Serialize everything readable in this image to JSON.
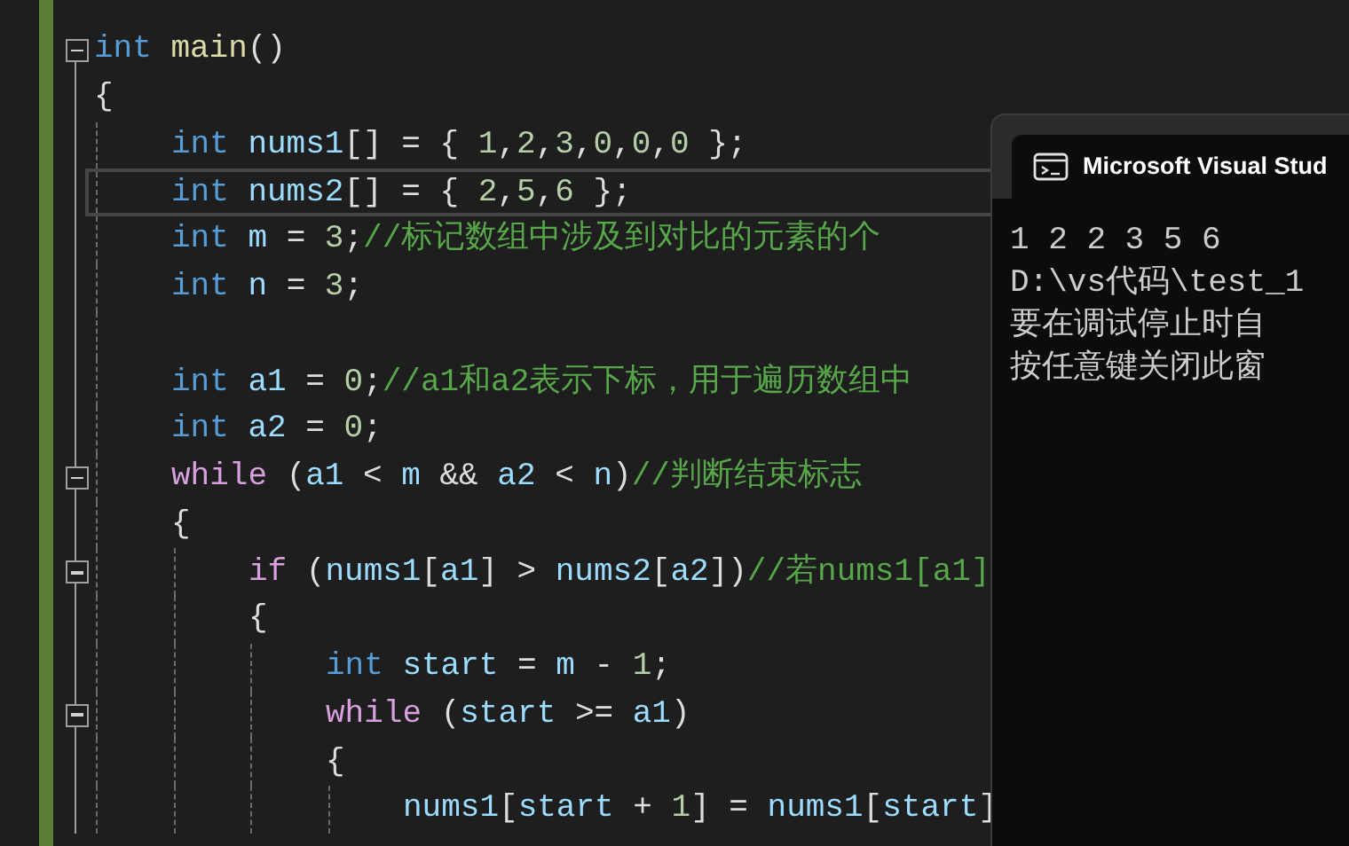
{
  "editor": {
    "lines": [
      {
        "kind": "code",
        "tokens": [
          {
            "kind": "keyword",
            "text": "int"
          },
          {
            "kind": "function",
            "text": " main"
          },
          {
            "kind": "punct",
            "text": "()"
          }
        ],
        "fold": {
          "expanded": true
        }
      },
      {
        "kind": "code",
        "tokens": [
          {
            "kind": "punct",
            "text": "{"
          }
        ],
        "children": [
          {
            "kind": "code",
            "tokens": [
              {
                "kind": "keyword",
                "text": "int"
              },
              {
                "kind": "variable",
                "text": " nums1"
              },
              {
                "kind": "punct",
                "text": "[] = { "
              },
              {
                "kind": "number",
                "text": "1"
              },
              {
                "kind": "punct",
                "text": ","
              },
              {
                "kind": "number",
                "text": "2"
              },
              {
                "kind": "punct",
                "text": ","
              },
              {
                "kind": "number",
                "text": "3"
              },
              {
                "kind": "punct",
                "text": ","
              },
              {
                "kind": "number",
                "text": "0"
              },
              {
                "kind": "punct",
                "text": ","
              },
              {
                "kind": "number",
                "text": "0"
              },
              {
                "kind": "punct",
                "text": ","
              },
              {
                "kind": "number",
                "text": "0"
              },
              {
                "kind": "punct",
                "text": " };"
              }
            ]
          },
          {
            "kind": "code",
            "tokens": [
              {
                "kind": "keyword",
                "text": "int"
              },
              {
                "kind": "variable",
                "text": " nums2"
              },
              {
                "kind": "punct",
                "text": "[] = { "
              },
              {
                "kind": "number",
                "text": "2"
              },
              {
                "kind": "punct",
                "text": ","
              },
              {
                "kind": "number",
                "text": "5"
              },
              {
                "kind": "punct",
                "text": ","
              },
              {
                "kind": "number",
                "text": "6"
              },
              {
                "kind": "punct",
                "text": " };"
              }
            ],
            "selected": true
          },
          {
            "kind": "code",
            "tokens": [
              {
                "kind": "keyword",
                "text": "int"
              },
              {
                "kind": "variable",
                "text": " m"
              },
              {
                "kind": "punct",
                "text": " = "
              },
              {
                "kind": "number",
                "text": "3"
              },
              {
                "kind": "punct",
                "text": ";"
              },
              {
                "kind": "comment",
                "text": "//标记数组中涉及到对比的元素的个"
              }
            ]
          },
          {
            "kind": "code",
            "tokens": [
              {
                "kind": "keyword",
                "text": "int"
              },
              {
                "kind": "variable",
                "text": " n"
              },
              {
                "kind": "punct",
                "text": " = "
              },
              {
                "kind": "number",
                "text": "3"
              },
              {
                "kind": "punct",
                "text": ";"
              }
            ]
          },
          {
            "kind": "blank"
          },
          {
            "kind": "code",
            "tokens": [
              {
                "kind": "keyword",
                "text": "int"
              },
              {
                "kind": "variable",
                "text": " a1"
              },
              {
                "kind": "punct",
                "text": " = "
              },
              {
                "kind": "number",
                "text": "0"
              },
              {
                "kind": "punct",
                "text": ";"
              },
              {
                "kind": "comment",
                "text": "//a1和a2表示下标，用于遍历数组中"
              }
            ]
          },
          {
            "kind": "code",
            "tokens": [
              {
                "kind": "keyword",
                "text": "int"
              },
              {
                "kind": "variable",
                "text": " a2"
              },
              {
                "kind": "punct",
                "text": " = "
              },
              {
                "kind": "number",
                "text": "0"
              },
              {
                "kind": "punct",
                "text": ";"
              }
            ]
          },
          {
            "kind": "code",
            "tokens": [
              {
                "kind": "control",
                "text": "while"
              },
              {
                "kind": "punct",
                "text": " ("
              },
              {
                "kind": "variable",
                "text": "a1"
              },
              {
                "kind": "punct",
                "text": " < "
              },
              {
                "kind": "variable",
                "text": "m"
              },
              {
                "kind": "punct",
                "text": " && "
              },
              {
                "kind": "variable",
                "text": "a2"
              },
              {
                "kind": "punct",
                "text": " < "
              },
              {
                "kind": "variable",
                "text": "n"
              },
              {
                "kind": "punct",
                "text": ")"
              },
              {
                "kind": "comment",
                "text": "//判断结束标志"
              }
            ],
            "fold": {
              "expanded": true
            }
          },
          {
            "kind": "code",
            "tokens": [
              {
                "kind": "punct",
                "text": "{"
              }
            ],
            "children": [
              {
                "kind": "code",
                "tokens": [
                  {
                    "kind": "control",
                    "text": "if"
                  },
                  {
                    "kind": "punct",
                    "text": " ("
                  },
                  {
                    "kind": "variable",
                    "text": "nums1"
                  },
                  {
                    "kind": "punct",
                    "text": "["
                  },
                  {
                    "kind": "variable",
                    "text": "a1"
                  },
                  {
                    "kind": "punct",
                    "text": "] > "
                  },
                  {
                    "kind": "variable",
                    "text": "nums2"
                  },
                  {
                    "kind": "punct",
                    "text": "["
                  },
                  {
                    "kind": "variable",
                    "text": "a2"
                  },
                  {
                    "kind": "punct",
                    "text": "])"
                  },
                  {
                    "kind": "comment",
                    "text": "//若nums1[a1]"
                  }
                ],
                "fold": {
                  "expanded": true
                }
              },
              {
                "kind": "code",
                "tokens": [
                  {
                    "kind": "punct",
                    "text": "{"
                  }
                ],
                "children": [
                  {
                    "kind": "code",
                    "tokens": [
                      {
                        "kind": "keyword",
                        "text": "int"
                      },
                      {
                        "kind": "variable",
                        "text": " start"
                      },
                      {
                        "kind": "punct",
                        "text": " = "
                      },
                      {
                        "kind": "variable",
                        "text": "m"
                      },
                      {
                        "kind": "punct",
                        "text": " - "
                      },
                      {
                        "kind": "number",
                        "text": "1"
                      },
                      {
                        "kind": "punct",
                        "text": ";"
                      }
                    ]
                  },
                  {
                    "kind": "code",
                    "tokens": [
                      {
                        "kind": "control",
                        "text": "while"
                      },
                      {
                        "kind": "punct",
                        "text": " ("
                      },
                      {
                        "kind": "variable",
                        "text": "start"
                      },
                      {
                        "kind": "punct",
                        "text": " >= "
                      },
                      {
                        "kind": "variable",
                        "text": "a1"
                      },
                      {
                        "kind": "punct",
                        "text": ")"
                      }
                    ],
                    "fold": {
                      "expanded": true
                    }
                  },
                  {
                    "kind": "code",
                    "tokens": [
                      {
                        "kind": "punct",
                        "text": "{"
                      }
                    ],
                    "children": [
                      {
                        "kind": "code",
                        "tokens": [
                          {
                            "kind": "variable",
                            "text": "nums1"
                          },
                          {
                            "kind": "punct",
                            "text": "["
                          },
                          {
                            "kind": "variable",
                            "text": "start"
                          },
                          {
                            "kind": "punct",
                            "text": " + "
                          },
                          {
                            "kind": "number",
                            "text": "1"
                          },
                          {
                            "kind": "punct",
                            "text": "] = "
                          },
                          {
                            "kind": "variable",
                            "text": "nums1"
                          },
                          {
                            "kind": "punct",
                            "text": "["
                          },
                          {
                            "kind": "variable",
                            "text": "start"
                          },
                          {
                            "kind": "punct",
                            "text": "]"
                          }
                        ]
                      }
                    ]
                  }
                ]
              }
            ]
          }
        ]
      }
    ]
  },
  "console": {
    "title": "Microsoft Visual Stud",
    "output": [
      "1 2 2 3 5 6",
      "D:\\vs代码\\test_1",
      "要在调试停止时自",
      "按任意键关闭此窗"
    ]
  }
}
